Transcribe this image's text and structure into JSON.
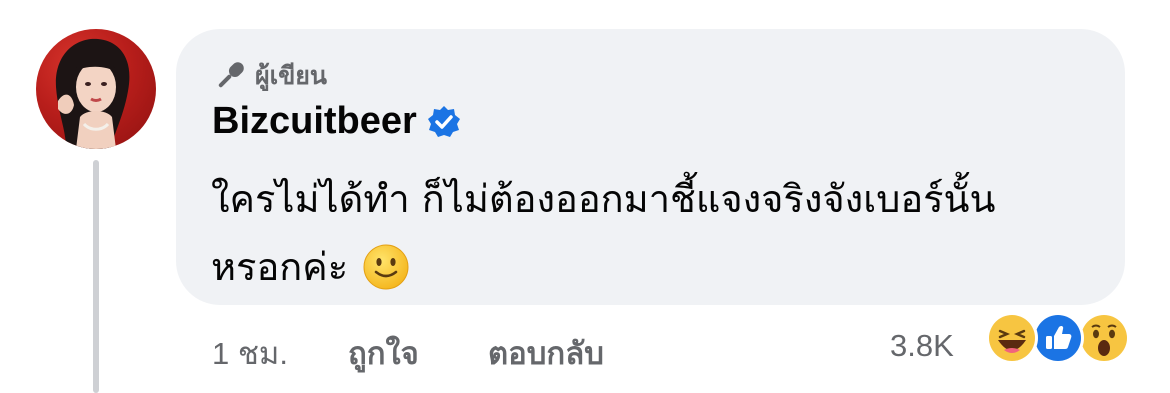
{
  "comment": {
    "author_badge": {
      "label": "ผู้เขียน",
      "icon": "microphone-icon"
    },
    "author_name": "Bizcuitbeer",
    "verified_icon": "verified-badge-icon",
    "text_line1": "ใครไม่ได้ทำ ก็ไม่ต้องออกมาชี้แจงจริงจังเบอร์นั้น",
    "text_line2": "หรอกค่ะ",
    "emoji": "slightly-smiling-face"
  },
  "meta": {
    "time": "1 ชม.",
    "like_label": "ถูกใจ",
    "reply_label": "ตอบกลับ",
    "reaction_count": "3.8K",
    "reactions": [
      "haha-reaction-icon",
      "like-reaction-icon",
      "wow-reaction-icon"
    ]
  },
  "colors": {
    "bubble": "#f0f2f5",
    "verified": "#1b74e4",
    "text": "#050505",
    "secondary_text": "#65676b"
  }
}
